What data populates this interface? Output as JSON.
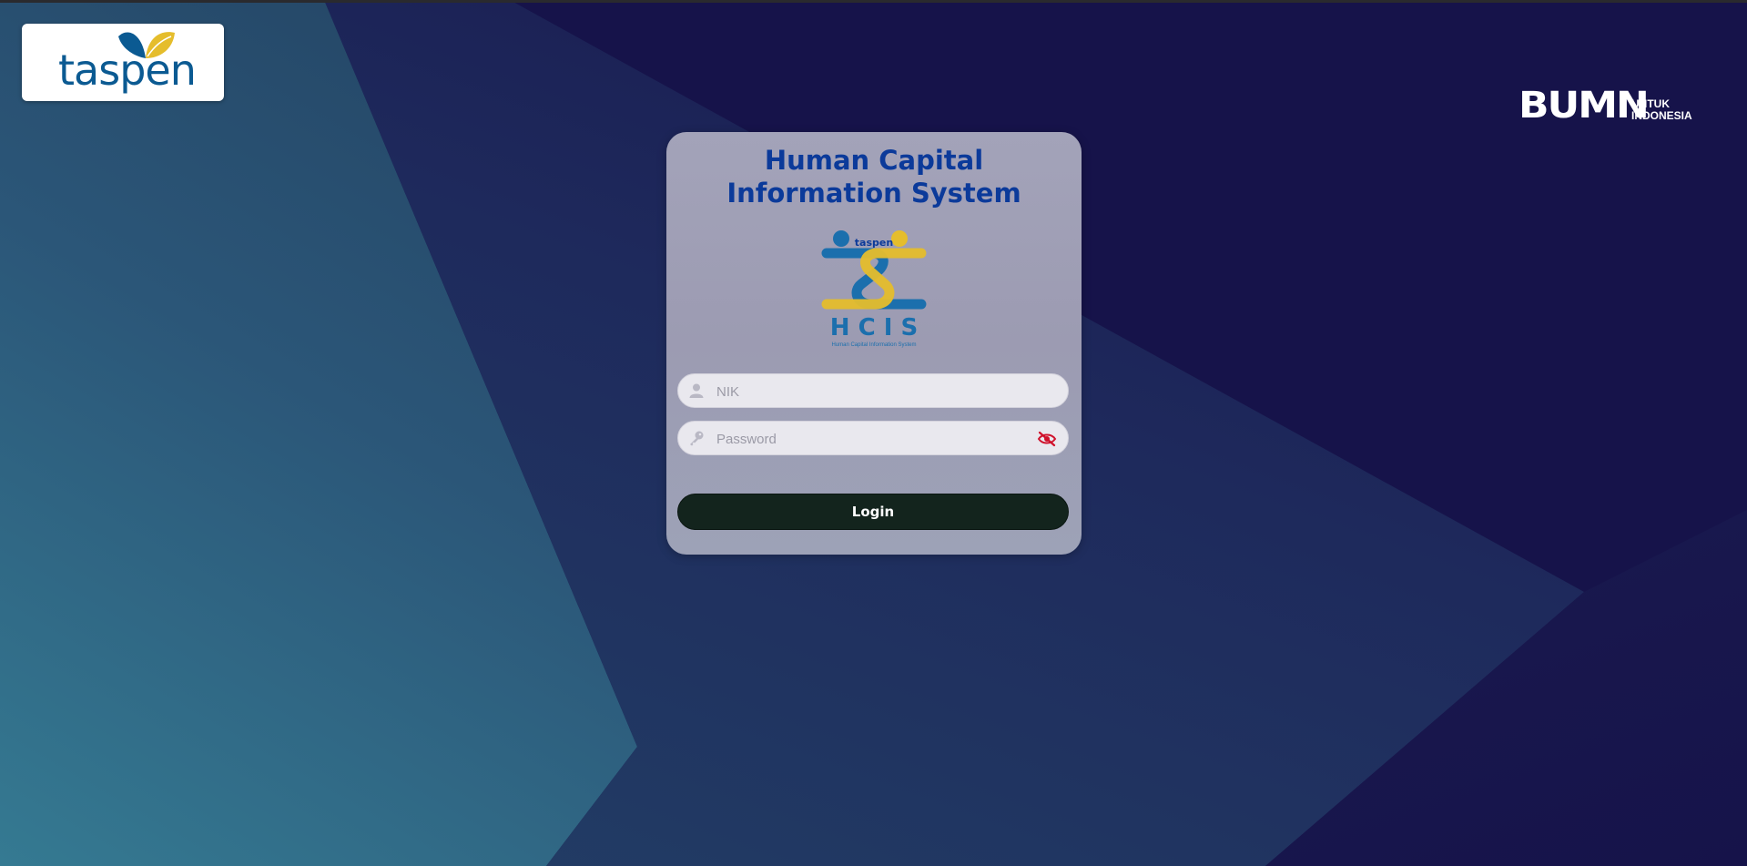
{
  "header": {
    "brand_logo_text": "taspen",
    "partner_logo": {
      "word": "BUMN",
      "line1": "UNTUK",
      "line2": "INDONESIA"
    }
  },
  "login_card": {
    "title_line1": "Human Capital",
    "title_line2": "Information System",
    "app_logo": {
      "brand": "taspen",
      "acronym": "H C I S",
      "tagline": "Human Capital Information System"
    },
    "nik_field": {
      "placeholder": "NIK",
      "value": "",
      "icon": "user-icon"
    },
    "password_field": {
      "placeholder": "Password",
      "value": "",
      "icon": "key-icon",
      "toggle_icon": "eye-slash-icon"
    },
    "login_button_label": "Login"
  },
  "colors": {
    "background": "#16134a",
    "title": "#0b3a9a",
    "login_button": "#13241d",
    "toggle_icon": "#d0112b",
    "brand_blue": "#0b5a92",
    "brand_yellow": "#e5bd2c"
  }
}
